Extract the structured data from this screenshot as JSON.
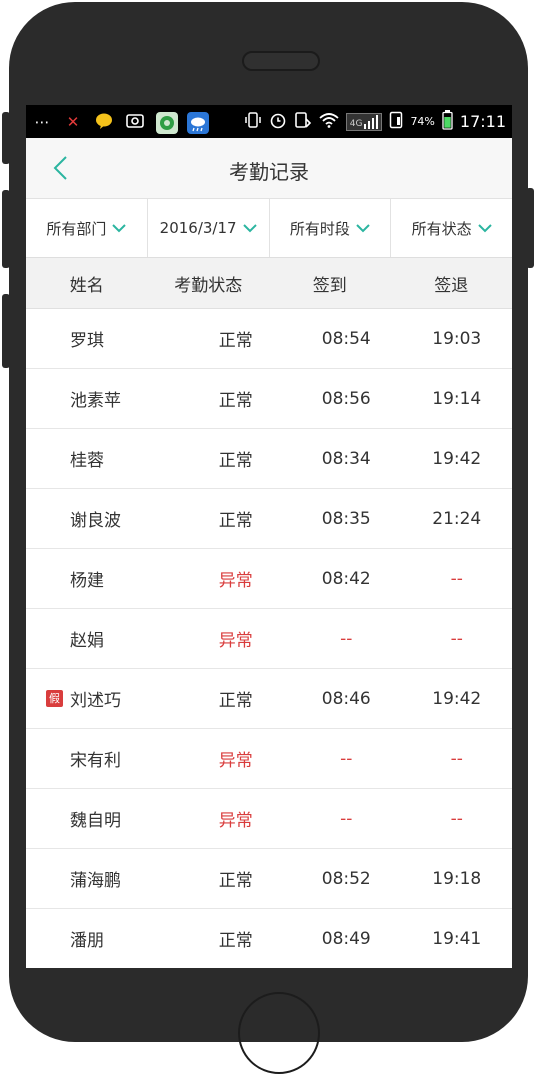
{
  "colors": {
    "accent": "#2bb5a0",
    "abnormal": "#d93d3d"
  },
  "status_bar": {
    "left_icons": [
      "more-icon",
      "missed-call-icon",
      "message-bubble-icon",
      "screenshot-icon",
      "app-flower-icon",
      "weather-icon"
    ],
    "network": "4G",
    "battery": "74%",
    "time": "17:11"
  },
  "header": {
    "title": "考勤记录"
  },
  "filters": {
    "department": "所有部门",
    "date": "2016/3/17",
    "period": "所有时段",
    "status": "所有状态"
  },
  "table": {
    "columns": [
      "姓名",
      "考勤状态",
      "签到",
      "签退"
    ],
    "rows": [
      {
        "name": "罗琪",
        "status": "正常",
        "check_in": "08:54",
        "check_out": "19:03"
      },
      {
        "name": "池素苹",
        "status": "正常",
        "check_in": "08:56",
        "check_out": "19:14"
      },
      {
        "name": "桂蓉",
        "status": "正常",
        "check_in": "08:34",
        "check_out": "19:42"
      },
      {
        "name": "谢良波",
        "status": "正常",
        "check_in": "08:35",
        "check_out": "21:24"
      },
      {
        "name": "杨建",
        "status": "异常",
        "check_in": "08:42",
        "check_out": "--"
      },
      {
        "name": "赵娟",
        "status": "异常",
        "check_in": "--",
        "check_out": "--"
      },
      {
        "name": "刘述巧",
        "status": "正常",
        "check_in": "08:46",
        "check_out": "19:42",
        "badge": "假"
      },
      {
        "name": "宋有利",
        "status": "异常",
        "check_in": "--",
        "check_out": "--"
      },
      {
        "name": "魏自明",
        "status": "异常",
        "check_in": "--",
        "check_out": "--"
      },
      {
        "name": "蒲海鹏",
        "status": "正常",
        "check_in": "08:52",
        "check_out": "19:18"
      },
      {
        "name": "潘朋",
        "status": "正常",
        "check_in": "08:49",
        "check_out": "19:41"
      }
    ]
  }
}
